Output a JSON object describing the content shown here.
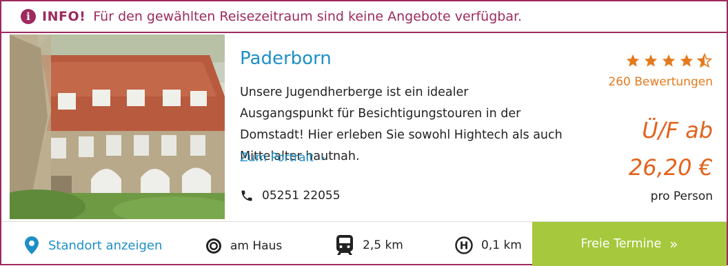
{
  "info": {
    "label": "INFO!",
    "message": "Für den gewählten Reisezeitraum sind keine Angebote verfügbar."
  },
  "hostel": {
    "name": "Paderborn",
    "description": "Unsere Jugendherberge ist ein idealer Ausgangspunkt für Besichtigungstouren in der Domstadt! Hier erleben Sie sowohl Hightech als auch Mittelalter hautnah.",
    "portrait_link": "Zum Portrait",
    "phone": "05251 22055"
  },
  "rating": {
    "stars": 4.5,
    "max": 5,
    "reviews": "260 Bewertungen"
  },
  "pricing": {
    "label": "Ü/F ab",
    "price": "26,20 €",
    "unit": "pro Person"
  },
  "footer": {
    "location": "Standort anzeigen",
    "stop_text": "am Haus",
    "train_text": "2,5 km",
    "bus_text": "0,1 km",
    "cta": "Freie Termine"
  },
  "icons": {
    "info": "info-icon",
    "phone": "phone-icon",
    "location": "map-pin-icon",
    "stop": "target-icon",
    "train": "train-icon",
    "bus": "bus-stop-icon",
    "chevron": "chevron-right-icon",
    "double_chevron": "double-chevron-right-icon"
  },
  "colors": {
    "brand": "#9c2a5e",
    "link": "#1e8fc6",
    "accent": "#e3621c",
    "star": "#e47a1e",
    "cta": "#a6c83c"
  }
}
